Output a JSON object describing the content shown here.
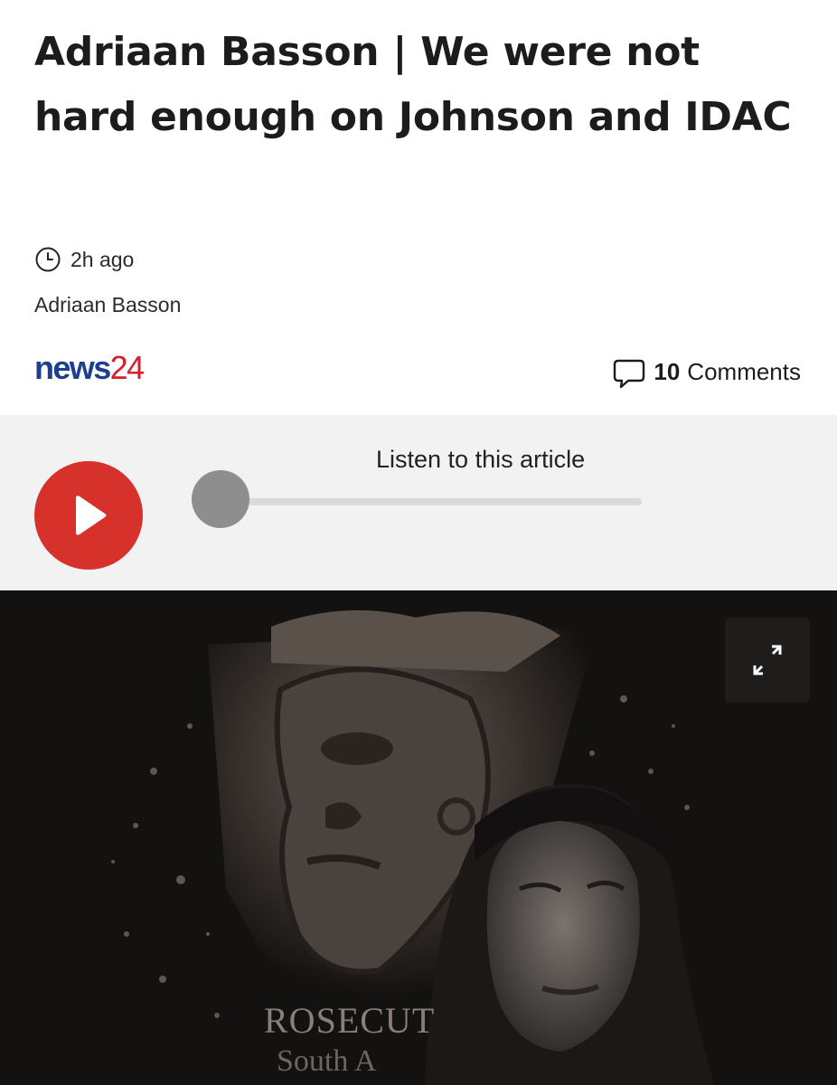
{
  "article": {
    "headline": "Adriaan Basson | We were not hard enough on Johnson and IDAC",
    "time_ago": "2h ago",
    "author": "Adriaan Basson",
    "clock_icon": "clock-icon"
  },
  "brand": {
    "logo_part1": "news",
    "logo_part2": "24",
    "logo_colors": {
      "news": "#1e3f8f",
      "num": "#d3202a"
    }
  },
  "comments": {
    "count": "10",
    "label": "Comments",
    "icon": "comment-bubble-icon"
  },
  "audio_player": {
    "label": "Listen to this article",
    "progress": 0,
    "play_icon": "play-icon",
    "accent": "#d6312b"
  },
  "hero_image": {
    "emblem_text_1": "ROSECUT",
    "emblem_text_2": "South A",
    "expand_icon": "expand-icon"
  }
}
